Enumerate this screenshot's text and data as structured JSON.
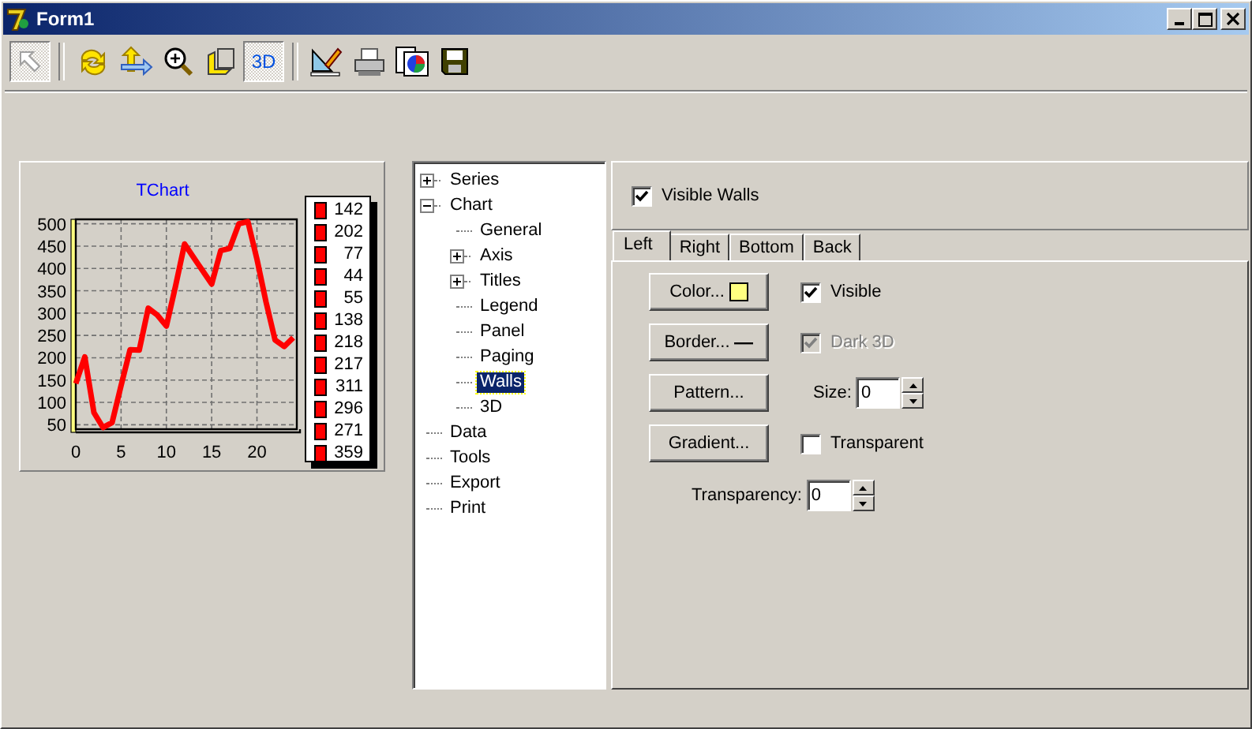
{
  "window": {
    "title": "Form1"
  },
  "toolbar": [
    {
      "kind": "arrow",
      "pressed": true
    },
    {
      "kind": "separator"
    },
    {
      "kind": "rotate",
      "pressed": false
    },
    {
      "kind": "move",
      "pressed": false
    },
    {
      "kind": "zoom",
      "pressed": false
    },
    {
      "kind": "depth",
      "pressed": false
    },
    {
      "kind": "threed",
      "label": "3D",
      "pressed": true
    },
    {
      "kind": "separator"
    },
    {
      "kind": "edit",
      "pressed": false
    },
    {
      "kind": "print",
      "pressed": false
    },
    {
      "kind": "export",
      "pressed": false
    },
    {
      "kind": "save",
      "pressed": false
    }
  ],
  "chart": {
    "legend": [
      "142",
      "202",
      "77",
      "44",
      "55",
      "138",
      "218",
      "217",
      "311",
      "296",
      "271",
      "359"
    ],
    "chart_data": {
      "type": "line",
      "title": "TChart",
      "x": [
        0,
        1,
        2,
        3,
        4,
        5,
        6,
        7,
        8,
        9,
        10,
        11,
        12,
        13,
        14,
        15,
        16,
        17,
        18,
        19,
        20,
        21,
        22,
        23,
        24
      ],
      "xlim": [
        0,
        24.4
      ],
      "ylim": [
        40,
        510
      ],
      "grid": true,
      "xticks": [
        0,
        5,
        10,
        15,
        20
      ],
      "yticks": [
        50,
        100,
        150,
        200,
        250,
        300,
        350,
        400,
        450,
        500
      ],
      "series": [
        {
          "color": "#ff0000",
          "values": [
            142,
            202,
            77,
            44,
            55,
            138,
            218,
            217,
            311,
            296,
            271,
            359,
            455,
            425,
            395,
            365,
            440,
            445,
            500,
            505,
            420,
            325,
            240,
            225,
            245
          ]
        }
      ]
    }
  },
  "tree": [
    {
      "label": "Series",
      "kind": "branch",
      "expanded": false,
      "selected": false
    },
    {
      "label": "Chart",
      "kind": "branch",
      "expanded": true,
      "selected": false,
      "children": [
        {
          "label": "General",
          "kind": "leaf",
          "selected": false
        },
        {
          "label": "Axis",
          "kind": "branch",
          "expanded": false,
          "selected": false
        },
        {
          "label": "Titles",
          "kind": "branch",
          "expanded": false,
          "selected": false
        },
        {
          "label": "Legend",
          "kind": "leaf",
          "selected": false
        },
        {
          "label": "Panel",
          "kind": "leaf",
          "selected": false
        },
        {
          "label": "Paging",
          "kind": "leaf",
          "selected": false
        },
        {
          "label": "Walls",
          "kind": "leaf",
          "selected": true
        },
        {
          "label": "3D",
          "kind": "leaf",
          "selected": false
        }
      ]
    },
    {
      "label": "Data",
      "kind": "leaf",
      "selected": false
    },
    {
      "label": "Tools",
      "kind": "leaf",
      "selected": false
    },
    {
      "label": "Export",
      "kind": "leaf",
      "selected": false
    },
    {
      "label": "Print",
      "kind": "leaf",
      "selected": false
    }
  ],
  "walls": {
    "visible_walls": {
      "label": "Visible Walls",
      "checked": true
    },
    "tabs": [
      {
        "label": "Left",
        "selected": true
      },
      {
        "label": "Right",
        "selected": false
      },
      {
        "label": "Bottom",
        "selected": false
      },
      {
        "label": "Back",
        "selected": false
      }
    ],
    "rows": [
      {
        "button": {
          "label": "Color...",
          "kind": "swatch",
          "color": "#ffff80"
        },
        "option": {
          "kind": "checkbox",
          "label": "Visible",
          "checked": true,
          "disabled": false
        }
      },
      {
        "button": {
          "label": "Border...",
          "kind": "line"
        },
        "option": {
          "kind": "checkbox",
          "label": "Dark 3D",
          "checked": true,
          "disabled": true
        }
      },
      {
        "button": {
          "label": "Pattern...",
          "kind": "plain"
        },
        "option": {
          "kind": "spin",
          "label": "Size:",
          "value": "0"
        }
      },
      {
        "button": {
          "label": "Gradient...",
          "kind": "plain"
        },
        "option": {
          "kind": "checkbox",
          "label": "Transparent",
          "checked": false,
          "disabled": false
        }
      }
    ],
    "transparency": {
      "label": "Transparency:",
      "value": "0"
    }
  }
}
